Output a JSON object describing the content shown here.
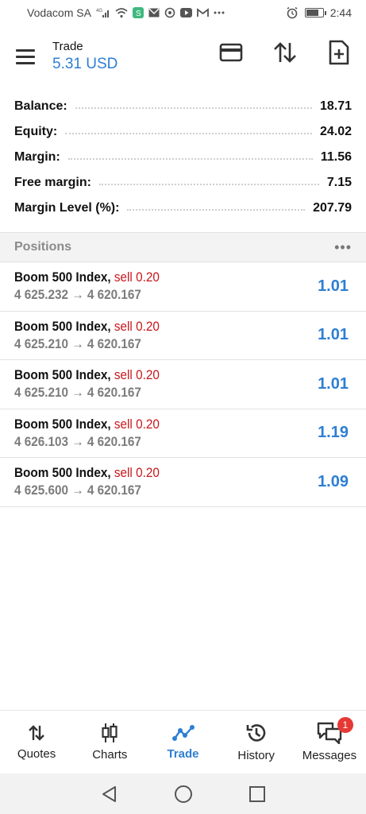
{
  "status_bar": {
    "carrier": "Vodacom SA",
    "network": "4G",
    "time": "2:44",
    "battery_level": 0.75
  },
  "header": {
    "title": "Trade",
    "balance_display": "5.31 USD"
  },
  "summary": [
    {
      "label": "Balance:",
      "value": "18.71"
    },
    {
      "label": "Equity:",
      "value": "24.02"
    },
    {
      "label": "Margin:",
      "value": "11.56"
    },
    {
      "label": "Free margin:",
      "value": "7.15"
    },
    {
      "label": "Margin Level (%):",
      "value": "207.79"
    }
  ],
  "positions": {
    "title": "Positions",
    "more": "•••",
    "items": [
      {
        "symbol": "Boom 500 Index,",
        "side": "sell 0.20",
        "prices": "4 625.232 → 4 620.167",
        "profit": "1.01"
      },
      {
        "symbol": "Boom 500 Index,",
        "side": "sell 0.20",
        "prices": "4 625.210 → 4 620.167",
        "profit": "1.01"
      },
      {
        "symbol": "Boom 500 Index,",
        "side": "sell 0.20",
        "prices": "4 625.210 → 4 620.167",
        "profit": "1.01"
      },
      {
        "symbol": "Boom 500 Index,",
        "side": "sell 0.20",
        "prices": "4 626.103 → 4 620.167",
        "profit": "1.19"
      },
      {
        "symbol": "Boom 500 Index,",
        "side": "sell 0.20",
        "prices": "4 625.600 → 4 620.167",
        "profit": "1.09"
      }
    ]
  },
  "bottom_nav": {
    "quotes": "Quotes",
    "charts": "Charts",
    "trade": "Trade",
    "history": "History",
    "messages": "Messages",
    "messages_badge": "1"
  },
  "colors": {
    "accent": "#2d7fd3",
    "sell": "#c8171b",
    "badge": "#e53935"
  }
}
